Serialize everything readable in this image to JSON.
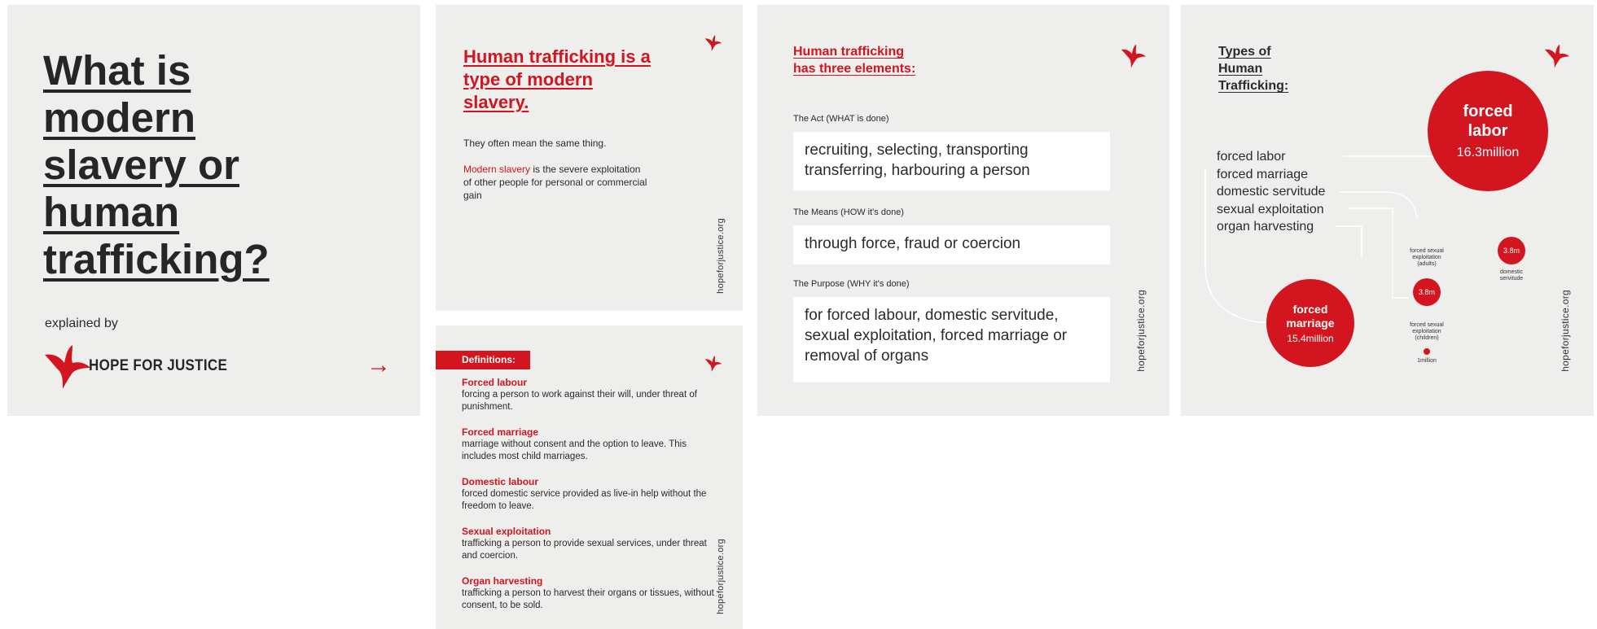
{
  "colors": {
    "accent": "#d2151f",
    "card_bg": "#eeeeed",
    "text": "#2b2b2b"
  },
  "icons": {
    "logo": "hope-bird-icon",
    "arrow": "arrow-right-icon"
  },
  "site": "hopeforjustice.org",
  "card1": {
    "title": "What is modern slavery or human trafficking?",
    "explained_by": "explained by",
    "logo_text": "HOPE FOR JUSTICE",
    "arrow": "→"
  },
  "card2": {
    "heading": "Human trafficking is a type of modern slavery.",
    "line1": "They often mean the same thing.",
    "term": "Modern slavery",
    "rest": " is the severe exploitation of other people for personal or commercial gain"
  },
  "card3": {
    "tag": "Definitions:",
    "definitions": [
      {
        "term": "Forced labour",
        "text": "forcing a person to work against their will, under threat of punishment."
      },
      {
        "term": "Forced marriage",
        "text": "marriage without consent and the option to leave. This includes most child marriages."
      },
      {
        "term": "Domestic labour",
        "text": "forced domestic service provided as live-in help without the freedom to leave."
      },
      {
        "term": "Sexual exploitation",
        "text": "trafficking a person to provide sexual services, under threat and coercion."
      },
      {
        "term": "Organ harvesting",
        "text": "trafficking a person to harvest their organs or tissues, without consent, to be sold."
      }
    ]
  },
  "card4": {
    "heading": "Human trafficking has three elements:",
    "act_label": "The Act (WHAT is done)",
    "act_text": "recruiting, selecting, transporting transferring, harbouring a person",
    "means_label": "The Means (HOW it's done)",
    "means_text": "through force, fraud or coercion",
    "purpose_label": "The Purpose (WHY it's done)",
    "purpose_text": "for forced labour, domestic servitude, sexual exploitation, forced marriage or removal of organs"
  },
  "card5": {
    "heading": "Types of Human Trafficking:",
    "types": [
      "forced labor",
      "forced marriage",
      "domestic servitude",
      "sexual exploitation",
      "organ harvesting"
    ],
    "bubbles": {
      "labor": {
        "name": "forced labor",
        "value": "16.3million"
      },
      "marriage": {
        "name": "forced marriage",
        "value": "15.4million"
      },
      "domestic": {
        "value": "3.8m",
        "label": "domestic servitude"
      },
      "sex_adults": {
        "value": "3.8m",
        "label": "forced sexual exploitation (adults)"
      },
      "sex_children": {
        "value": "1million",
        "label": "forced sexual exploitation (children)"
      }
    }
  }
}
